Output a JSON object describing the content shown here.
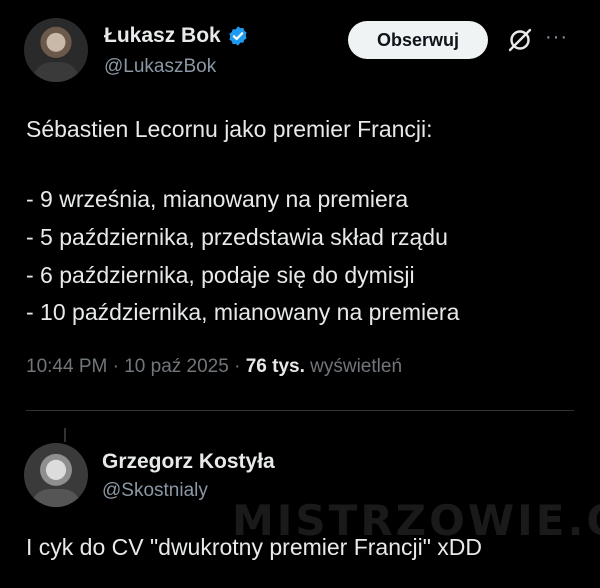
{
  "post": {
    "author_name": "Łukasz Bok",
    "author_handle": "@LukaszBok",
    "follow_label": "Obserwuj",
    "more_label": "···",
    "lines": [
      "Sébastien Lecornu jako premier Francji:",
      "- 9 września, mianowany na premiera",
      "- 5 października, przedstawia skład rządu",
      "- 6 października, podaje się do dymisji",
      "- 10 października, mianowany na premiera"
    ],
    "time": "10:44 PM",
    "date": "10 paź 2025",
    "views_count": "76 tys.",
    "views_label": "wyświetleń"
  },
  "reply": {
    "author_name": "Grzegorz Kostyła",
    "author_handle": "@Skostnialy",
    "text": "I cyk do CV \"dwukrotny premier Francji\" xDD"
  },
  "watermark": "MISTRZOWIE.ORG",
  "colors": {
    "background": "#000000",
    "text": "#e7e9ea",
    "secondary": "#71767b",
    "verified": "#1d9bf0",
    "button_bg": "#eff3f4"
  }
}
